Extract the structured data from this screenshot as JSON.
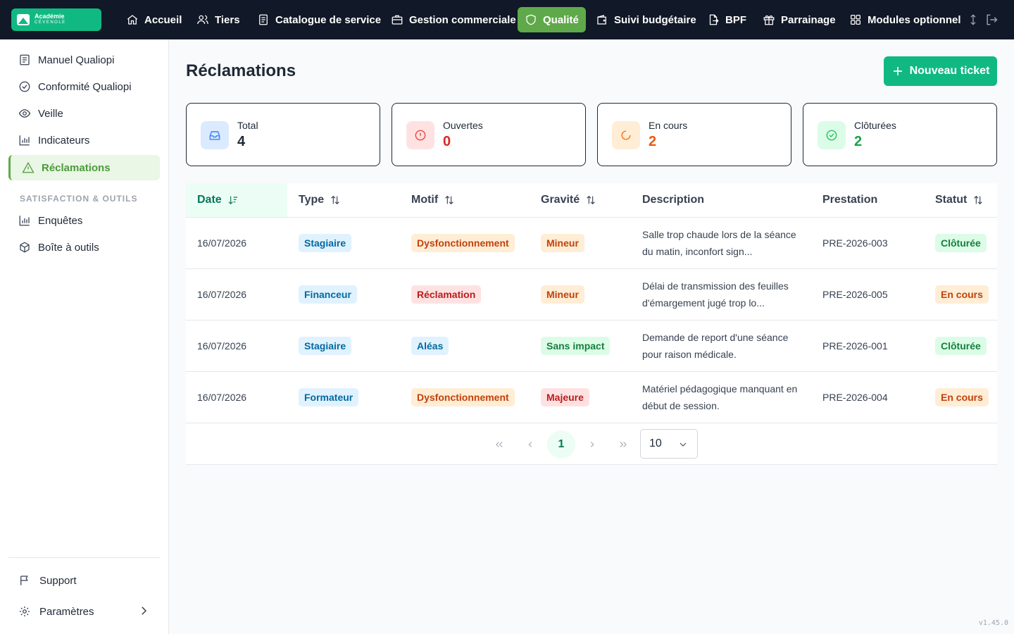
{
  "brand": {
    "line1": "Académie",
    "line2": "CÉVENOLE"
  },
  "nav": {
    "items": [
      {
        "label": "Accueil",
        "icon": "home-icon"
      },
      {
        "label": "Tiers",
        "icon": "users-icon"
      },
      {
        "label": "Catalogue de service",
        "icon": "document-icon"
      },
      {
        "label": "Gestion commerciale",
        "icon": "briefcase-icon"
      },
      {
        "label": "Qualité",
        "icon": "shield-icon",
        "active": true
      },
      {
        "label": "Suivi budgétaire",
        "icon": "wallet-icon"
      },
      {
        "label": "BPF",
        "icon": "file-arrow-icon"
      },
      {
        "label": "Parrainage",
        "icon": "gift-icon"
      },
      {
        "label": "Modules optionnel",
        "icon": "grid-icon"
      }
    ],
    "active_color": "#5fa94a"
  },
  "sidebar": {
    "items": [
      {
        "label": "Manuel Qualiopi",
        "icon": "book-icon"
      },
      {
        "label": "Conformité Qualiopi",
        "icon": "check-circle-icon"
      },
      {
        "label": "Veille",
        "icon": "eye-icon"
      },
      {
        "label": "Indicateurs",
        "icon": "bar-chart-icon"
      },
      {
        "label": "Réclamations",
        "icon": "warning-icon",
        "active": true
      }
    ],
    "section_title": "SATISFACTION & OUTILS",
    "section_items": [
      {
        "label": "Enquêtes",
        "icon": "bar-chart-icon"
      },
      {
        "label": "Boîte à outils",
        "icon": "box-icon"
      }
    ],
    "support_label": "Support",
    "settings_label": "Paramètres"
  },
  "main": {
    "title": "Réclamations",
    "new_button_label": "Nouveau ticket",
    "stats": [
      {
        "label": "Total",
        "value": "4",
        "color": "#1f2937"
      },
      {
        "label": "Ouvertes",
        "value": "0",
        "color": "#dc2626"
      },
      {
        "label": "En cours",
        "value": "2",
        "color": "#ea580c"
      },
      {
        "label": "Clôturées",
        "value": "2",
        "color": "#16a34a"
      }
    ]
  },
  "table": {
    "columns": [
      "Date",
      "Type",
      "Motif",
      "Gravité",
      "Description",
      "Prestation",
      "Statut"
    ],
    "rows": [
      {
        "date": "16/07/2026",
        "type": "Stagiaire",
        "motif": "Dysfonctionnement",
        "gravite": "Mineur",
        "description": "Salle trop chaude lors de la séance du matin, inconfort sign...",
        "prestation": "PRE-2026-003",
        "statut": "Clôturée"
      },
      {
        "date": "16/07/2026",
        "type": "Financeur",
        "motif": "Réclamation",
        "gravite": "Mineur",
        "description": "Délai de transmission des feuilles d'émargement jugé trop lo...",
        "prestation": "PRE-2026-005",
        "statut": "En cours"
      },
      {
        "date": "16/07/2026",
        "type": "Stagiaire",
        "motif": "Aléas",
        "gravite": "Sans impact",
        "description": "Demande de report d'une séance pour raison médicale.",
        "prestation": "PRE-2026-001",
        "statut": "Clôturée"
      },
      {
        "date": "16/07/2026",
        "type": "Formateur",
        "motif": "Dysfonctionnement",
        "gravite": "Majeure",
        "description": "Matériel pédagogique manquant en début de session.",
        "prestation": "PRE-2026-004",
        "statut": "En cours"
      }
    ]
  },
  "pagination": {
    "current_page": "1",
    "page_size": "10"
  },
  "version": "v1.45.0"
}
